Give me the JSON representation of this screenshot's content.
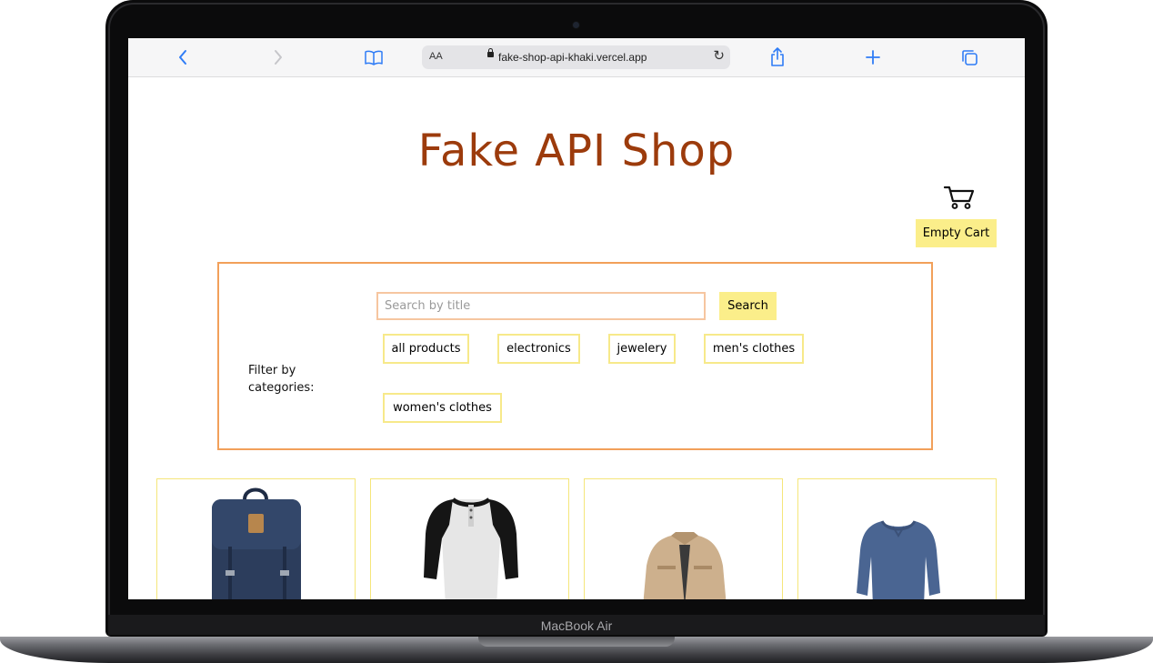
{
  "device": {
    "label": "MacBook Air"
  },
  "browser": {
    "aa_label": "AA",
    "url": "fake-shop-api-khaki.vercel.app"
  },
  "page": {
    "title": "Fake API Shop",
    "empty_cart_label": "Empty Cart",
    "filter": {
      "label": "Filter by categories:",
      "search_placeholder": "Search by title",
      "search_button": "Search",
      "categories": [
        "all products",
        "electronics",
        "jewelery",
        "men's clothes",
        "women's clothes"
      ]
    },
    "products": [
      {
        "image": "backpack-image"
      },
      {
        "image": "raglan-shirt-image"
      },
      {
        "image": "jacket-image"
      },
      {
        "image": "long-sleeve-tee-image"
      }
    ]
  },
  "colors": {
    "accent": "#9c3b0c",
    "button_bg": "#fbee8a",
    "filter_border": "#f2a05a",
    "browser_blue": "#2f7cf6"
  }
}
